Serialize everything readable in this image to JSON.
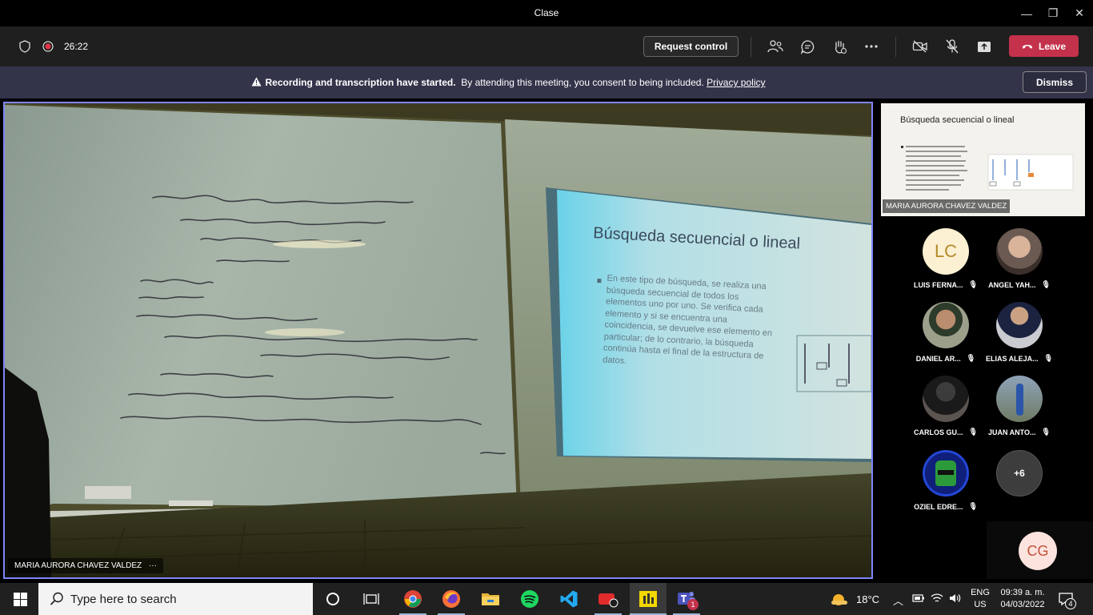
{
  "window": {
    "title": "Clase",
    "minimize": "—",
    "maximize": "❐",
    "close": "✕"
  },
  "toolbar": {
    "timer": "26:22",
    "request_control": "Request control",
    "leave_label": "Leave"
  },
  "banner": {
    "bold_text": "Recording and transcription have started.",
    "text": "By attending this meeting, you consent to being included.",
    "link": "Privacy policy",
    "dismiss": "Dismiss"
  },
  "stage": {
    "presenter": "MARIA AURORA CHAVEZ VALDEZ",
    "more": "···",
    "slide_title": "Búsqueda secuencial o lineal",
    "slide_body": "En este tipo de búsqueda, se realiza una búsqueda secuencial de todos los elementos uno por uno. Se verifica cada elemento y si se encuentra una coincidencia, se devuelve ese elemento en particular; de lo contrario, la búsqueda continúa hasta el final de la estructura de datos."
  },
  "pip": {
    "name": "MARIA AURORA CHAVEZ VALDEZ",
    "slide_title": "Búsqueda secuencial o lineal"
  },
  "participants": [
    {
      "name": "LUIS FERNA...",
      "initials": "LC",
      "avatar": "initials"
    },
    {
      "name": "ANGEL YAH...",
      "avatar": "photo"
    },
    {
      "name": "DANIEL AR...",
      "avatar": "photo"
    },
    {
      "name": "ELIAS ALEJA...",
      "avatar": "photo"
    },
    {
      "name": "CARLOS GU...",
      "avatar": "photo"
    },
    {
      "name": "JUAN ANTO...",
      "avatar": "photo"
    },
    {
      "name": "OZIEL EDRE...",
      "avatar": "photo"
    }
  ],
  "overflow": {
    "count": "+6"
  },
  "self": {
    "initials": "CG"
  },
  "taskbar": {
    "search_placeholder": "Type here to search",
    "weather_temp": "18°C",
    "lang_line1": "ENG",
    "lang_line2": "US",
    "time": "09:39 a. m.",
    "date": "04/03/2022",
    "notifications": "4",
    "teams_badge": "1"
  },
  "colors": {
    "accent": "#7f85f5",
    "leave": "#c4314b",
    "banner": "#33344a",
    "lc_avatar": "#fbf0d2",
    "cg_avatar": "#fde3de"
  }
}
